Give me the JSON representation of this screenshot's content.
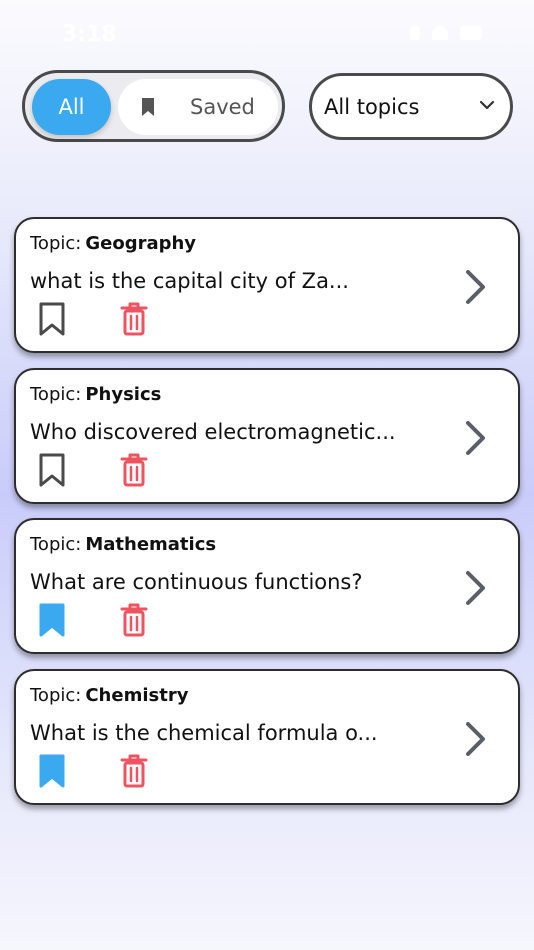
{
  "status_bar": {
    "time": "3:18"
  },
  "filter": {
    "all_label": "All",
    "saved_label": "Saved",
    "topic_select": "All topics"
  },
  "colors": {
    "accent": "#3aa9ef",
    "delete": "#ef5360",
    "bookmark_saved": "#3aa9ef",
    "bookmark_unsaved": "#4a4a4a"
  },
  "icons": [
    "bookmark-icon",
    "trash-icon",
    "chevron-right-icon",
    "chevron-down-icon"
  ],
  "cards": [
    {
      "topic_prefix": "Topic:",
      "topic": "Geography",
      "question": "what is the capital city of Za...",
      "saved": false
    },
    {
      "topic_prefix": "Topic:",
      "topic": "Physics",
      "question": "Who discovered electromagnetic...",
      "saved": false
    },
    {
      "topic_prefix": "Topic:",
      "topic": "Mathematics",
      "question": "What are continuous functions?",
      "saved": true
    },
    {
      "topic_prefix": "Topic:",
      "topic": "Chemistry",
      "question": "What is the chemical formula o...",
      "saved": true
    }
  ]
}
